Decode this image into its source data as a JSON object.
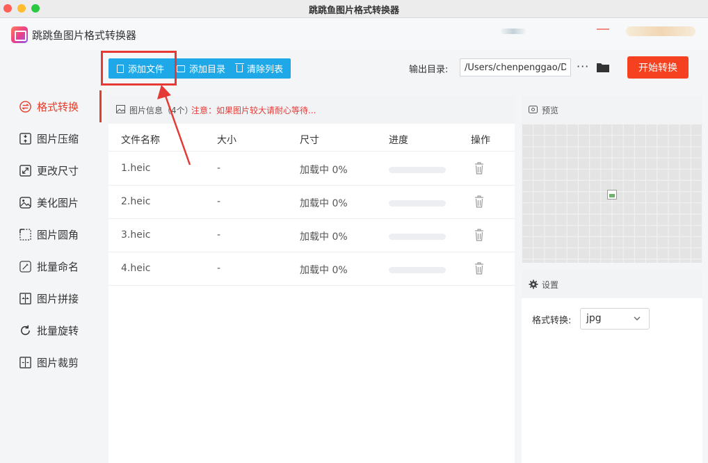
{
  "window": {
    "title": "跳跳鱼图片格式转换器"
  },
  "app": {
    "name": "跳跳鱼图片格式转换器"
  },
  "toolbar": {
    "add_file": "添加文件",
    "add_dir": "添加目录",
    "clear_list": "清除列表",
    "output_label": "输出目录:",
    "output_path": "/Users/chenpenggao/Desktop",
    "more": "···",
    "start": "开始转换"
  },
  "sidebar": {
    "items": [
      {
        "label": "格式转换",
        "icon": "swap-icon",
        "active": true
      },
      {
        "label": "图片压缩",
        "icon": "compress-icon"
      },
      {
        "label": "更改尺寸",
        "icon": "resize-icon"
      },
      {
        "label": "美化图片",
        "icon": "beautify-icon"
      },
      {
        "label": "图片圆角",
        "icon": "rounded-corner-icon"
      },
      {
        "label": "批量命名",
        "icon": "rename-icon"
      },
      {
        "label": "图片拼接",
        "icon": "merge-icon"
      },
      {
        "label": "批量旋转",
        "icon": "rotate-icon"
      },
      {
        "label": "图片裁剪",
        "icon": "crop-icon"
      }
    ]
  },
  "files": {
    "title": "图片信息（4个）",
    "note": "注意：如果图片较大请耐心等待...",
    "columns": [
      "文件名称",
      "大小",
      "尺寸",
      "进度",
      "操作"
    ],
    "rows": [
      {
        "name": "1.heic",
        "size": "-",
        "dimension": "加载中 0%",
        "progress": 0
      },
      {
        "name": "2.heic",
        "size": "-",
        "dimension": "加载中 0%",
        "progress": 0
      },
      {
        "name": "3.heic",
        "size": "-",
        "dimension": "加载中 0%",
        "progress": 0
      },
      {
        "name": "4.heic",
        "size": "-",
        "dimension": "加载中 0%",
        "progress": 0
      }
    ]
  },
  "preview": {
    "title": "预览"
  },
  "settings": {
    "title": "设置",
    "format_label": "格式转换:",
    "format_value": "jpg"
  },
  "colors": {
    "accent": "#1fa8e8",
    "brand_red": "#e63c2a",
    "start_button": "#f5411f"
  }
}
